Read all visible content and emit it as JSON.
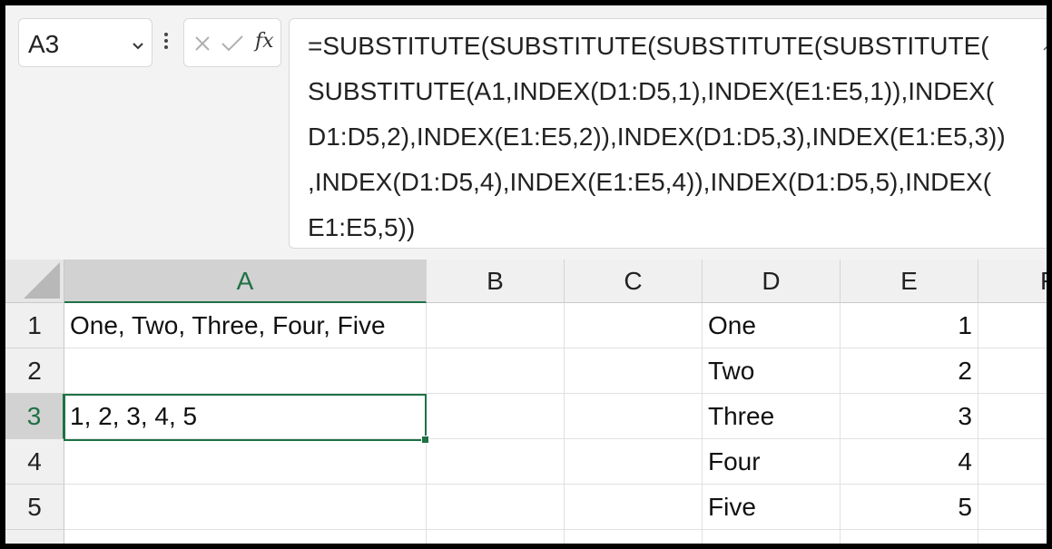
{
  "name_box": {
    "value": "A3"
  },
  "formula_bar": {
    "fx_label": "fx",
    "lines": [
      "=SUBSTITUTE(SUBSTITUTE(SUBSTITUTE(SUBSTITUTE(",
      "SUBSTITUTE(A1,INDEX(D1:D5,1),INDEX(E1:E5,1)),INDEX(",
      "D1:D5,2),INDEX(E1:E5,2)),INDEX(D1:D5,3),INDEX(E1:E5,3))",
      ",INDEX(D1:D5,4),INDEX(E1:E5,4)),INDEX(D1:D5,5),INDEX(",
      "E1:E5,5))"
    ]
  },
  "columns": [
    "A",
    "B",
    "C",
    "D",
    "E",
    "F"
  ],
  "rows": [
    "1",
    "2",
    "3",
    "4",
    "5"
  ],
  "cells": {
    "A1": "One, Two, Three, Four, Five",
    "A3": "1, 2, 3, 4, 5",
    "D1": "One",
    "D2": "Two",
    "D3": "Three",
    "D4": "Four",
    "D5": "Five",
    "E1": "1",
    "E2": "2",
    "E3": "3",
    "E4": "4",
    "E5": "5"
  },
  "icons": [
    "chevron-down-icon",
    "more-icon",
    "cancel-icon",
    "enter-icon",
    "insert-function-icon",
    "scroll-up-icon",
    "select-all-icon"
  ],
  "colors": {
    "accent": "#1e7145",
    "header_bg": "#f0f0f0",
    "selected_header_bg": "#d2d2d2"
  }
}
